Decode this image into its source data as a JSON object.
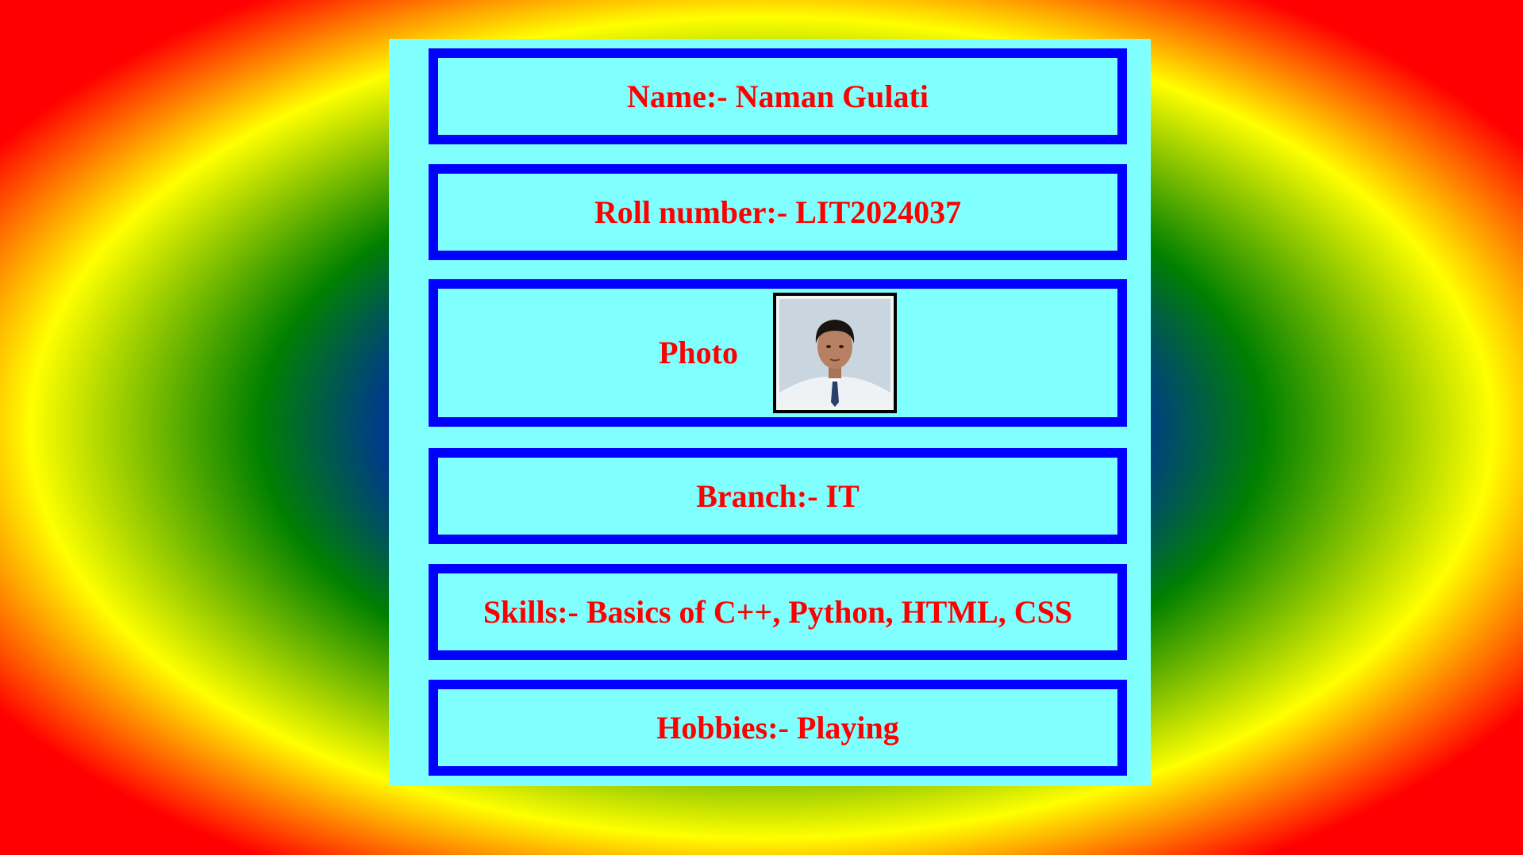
{
  "colors": {
    "card_background": "#80ffff",
    "border": "#0000ff",
    "text": "#ff0000"
  },
  "profile": {
    "name": "Name:- Naman Gulati",
    "roll": "Roll number:- LIT2024037",
    "photo_label": "Photo",
    "branch": "Branch:- IT",
    "skills": "Skills:- Basics of C++, Python, HTML, CSS",
    "hobbies": "Hobbies:- Playing"
  }
}
